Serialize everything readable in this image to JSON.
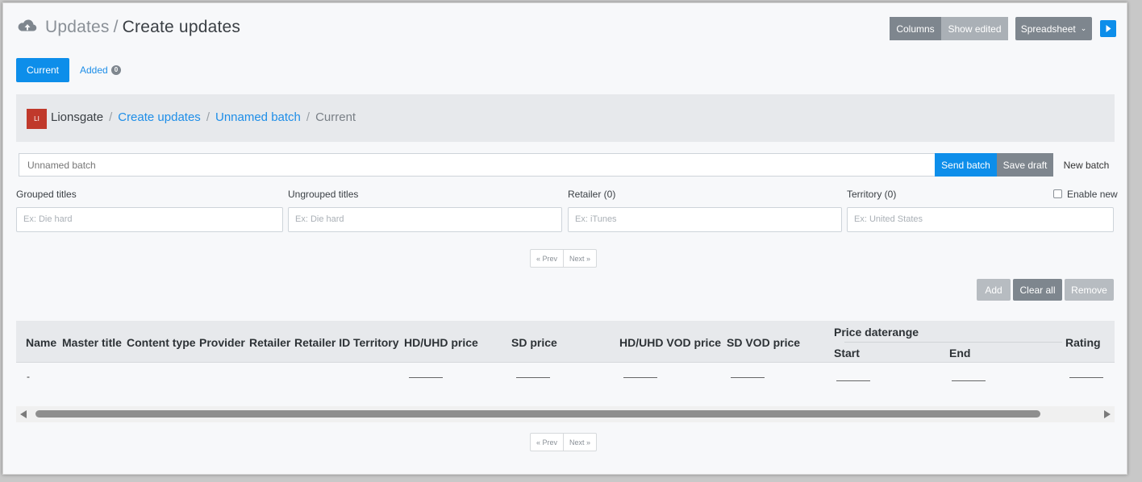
{
  "header": {
    "icon": "cloud-upload-icon",
    "title_parent": "Updates",
    "title_separator": "/",
    "title_current": "Create updates",
    "columns_label": "Columns",
    "show_edited_label": "Show edited",
    "spreadsheet_label": "Spreadsheet",
    "play_icon": "play-icon"
  },
  "tabs": {
    "current_label": "Current",
    "added_label": "Added",
    "added_count": "0"
  },
  "breadcrumb": {
    "logo_text": "LI",
    "company": "Lionsgate",
    "create_updates": "Create updates",
    "batch": "Unnamed batch",
    "current": "Current",
    "separator": "/"
  },
  "batch": {
    "name_placeholder": "Unnamed batch",
    "send_label": "Send batch",
    "save_label": "Save draft",
    "new_label": "New batch"
  },
  "filters": {
    "grouped_label": "Grouped titles",
    "grouped_placeholder": "Ex: Die hard",
    "ungrouped_label": "Ungrouped titles",
    "ungrouped_placeholder": "Ex: Die hard",
    "retailer_label": "Retailer (0)",
    "retailer_placeholder": "Ex: iTunes",
    "territory_label": "Territory (0)",
    "territory_placeholder": "Ex: United States",
    "enable_new_label": "Enable new",
    "enable_new_checked": false
  },
  "pager": {
    "prev_label": "« Prev",
    "next_label": "Next »"
  },
  "actions": {
    "add_label": "Add",
    "clear_all_label": "Clear all",
    "remove_label": "Remove"
  },
  "table": {
    "columns": [
      "Name",
      "Master title",
      "Content type",
      "Provider",
      "Retailer",
      "Retailer ID",
      "Territory",
      "HD/UHD price",
      "SD price",
      "HD/UHD VOD price",
      "SD VOD price",
      "Price daterange",
      "Rating"
    ],
    "daterange_sub": [
      "Start",
      "End"
    ],
    "row": {
      "name": "-"
    }
  },
  "colors": {
    "primary": "#0d8eea",
    "secondary": "#7e868e",
    "muted": "#b7bcc1",
    "logo_red": "#c0392b"
  }
}
